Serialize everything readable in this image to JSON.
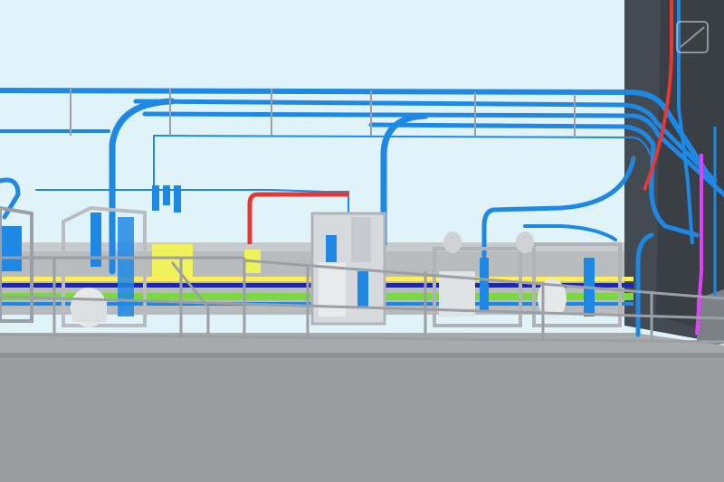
{
  "scene": {
    "description_visible_text": "",
    "colors": {
      "sky": "#dff3f9",
      "pipe_blue": "#1e88e5",
      "pipe_blue_dark": "#1565c0",
      "pipe_red": "#e53935",
      "pipe_magenta": "#e040fb",
      "pipe_yellow": "#ffee58",
      "pipe_green": "#7cd83f",
      "pipe_navy": "#1a23c8",
      "deck": "#a7aaad",
      "deck_dark": "#8e9194",
      "wall": "#444a52",
      "equipment": "#cfd3d6",
      "railing": "#9aa0a5"
    },
    "icons": [
      "watermark-logo-icon"
    ]
  }
}
